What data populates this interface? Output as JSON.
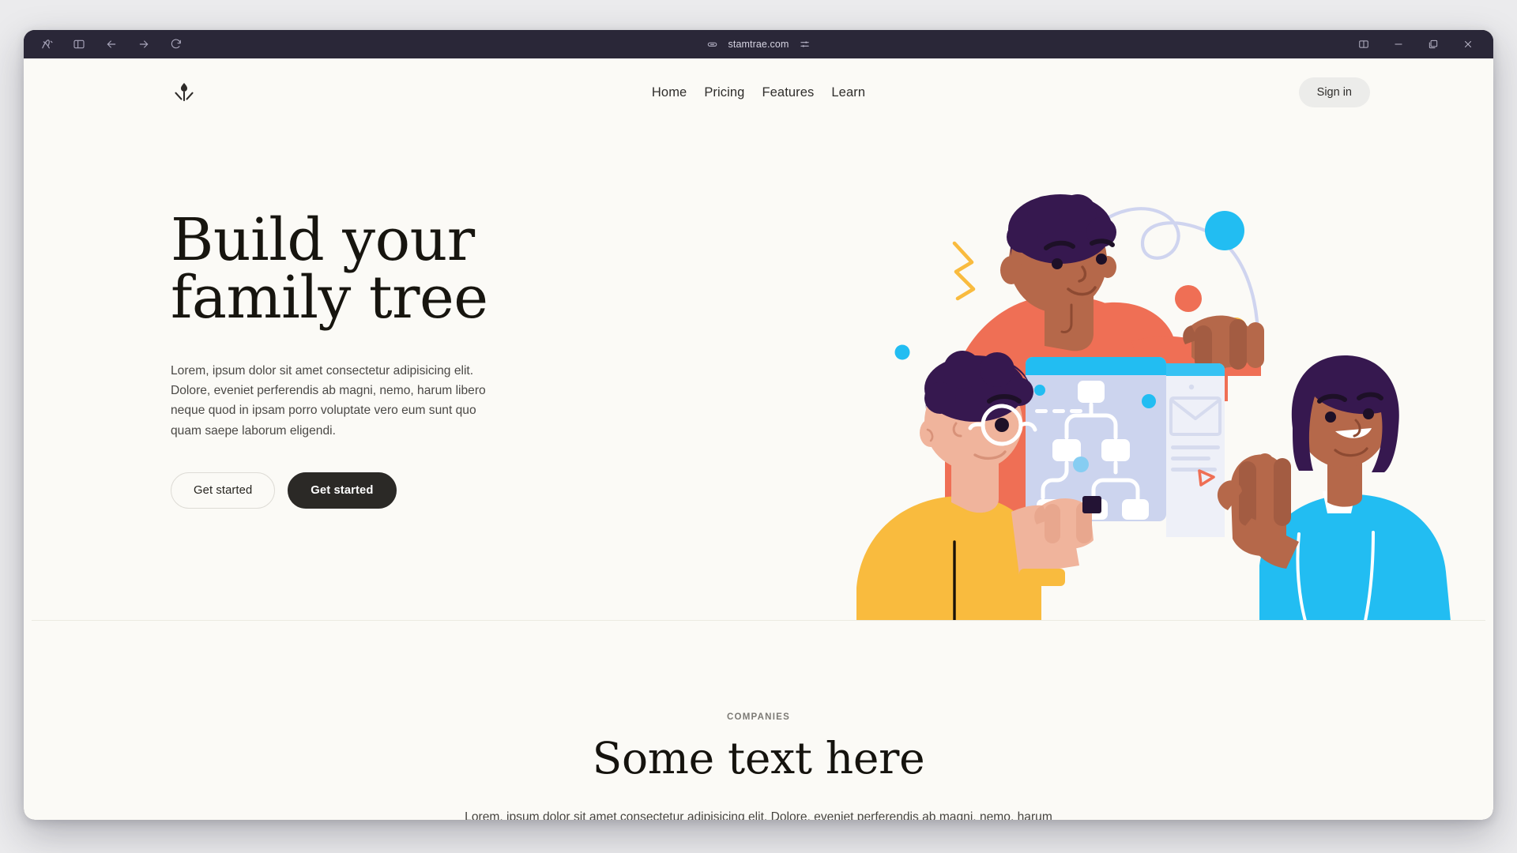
{
  "browser": {
    "toolbar_icons": [
      {
        "name": "arc-logo-icon",
        "label": "Arc"
      },
      {
        "name": "sidebar-toggle-icon",
        "label": "Toggle sidebar"
      },
      {
        "name": "back-arrow-icon",
        "label": "Back"
      },
      {
        "name": "forward-arrow-icon",
        "label": "Forward"
      },
      {
        "name": "reload-icon",
        "label": "Reload"
      }
    ],
    "url": "stamtrae.com",
    "url_left_icon": "link-icon",
    "url_right_icon": "sliders-icon",
    "window_controls": [
      {
        "name": "split-view-icon",
        "label": "Split view"
      },
      {
        "name": "minimize-icon",
        "label": "Minimize"
      },
      {
        "name": "maximize-icon",
        "label": "Maximize"
      },
      {
        "name": "close-icon",
        "label": "Close"
      }
    ],
    "chrome_bg": "#2a2738"
  },
  "site": {
    "logo_name": "stamtrae-logo-icon",
    "nav": [
      {
        "label": "Home"
      },
      {
        "label": "Pricing"
      },
      {
        "label": "Features"
      },
      {
        "label": "Learn"
      }
    ],
    "signin_label": "Sign in"
  },
  "hero": {
    "title_line1": "Build your",
    "title_line2": "family tree",
    "paragraph": "Lorem, ipsum dolor sit amet consectetur adipisicing elit. Dolore, eveniet perferendis ab magni, nemo, harum libero neque quod in ipsam porro voluptate vero eum sunt quo quam saepe laborum eligendi.",
    "button_outline_label": "Get started",
    "button_solid_label": "Get started",
    "illustration_name": "family-tree-illustration"
  },
  "companies": {
    "eyebrow": "COMPANIES",
    "title": "Some text here",
    "paragraph": "Lorem, ipsum dolor sit amet consectetur adipisicing elit. Dolore, eveniet perferendis ab magni, nemo, harum libero neque quod in ipsam porro voluptate vero eum sunt quo quam saepe laborum eligendi."
  },
  "colors": {
    "page_bg": "#fbfaf6",
    "ink": "#17150f",
    "muted": "#4a4845",
    "coral": "#ef6f55",
    "cyan": "#22bdf2",
    "amber": "#f9b93c",
    "yellow": "#f9bb3e",
    "purple": "#36184f",
    "skin_dark": "#b5684a",
    "skin_light": "#f0b49c",
    "tablet": "#ccd4ee",
    "paper": "#eef0f8",
    "lavender": "#cfd4ef",
    "dark_btn": "#2b2926",
    "signin_bg": "#ececea"
  }
}
